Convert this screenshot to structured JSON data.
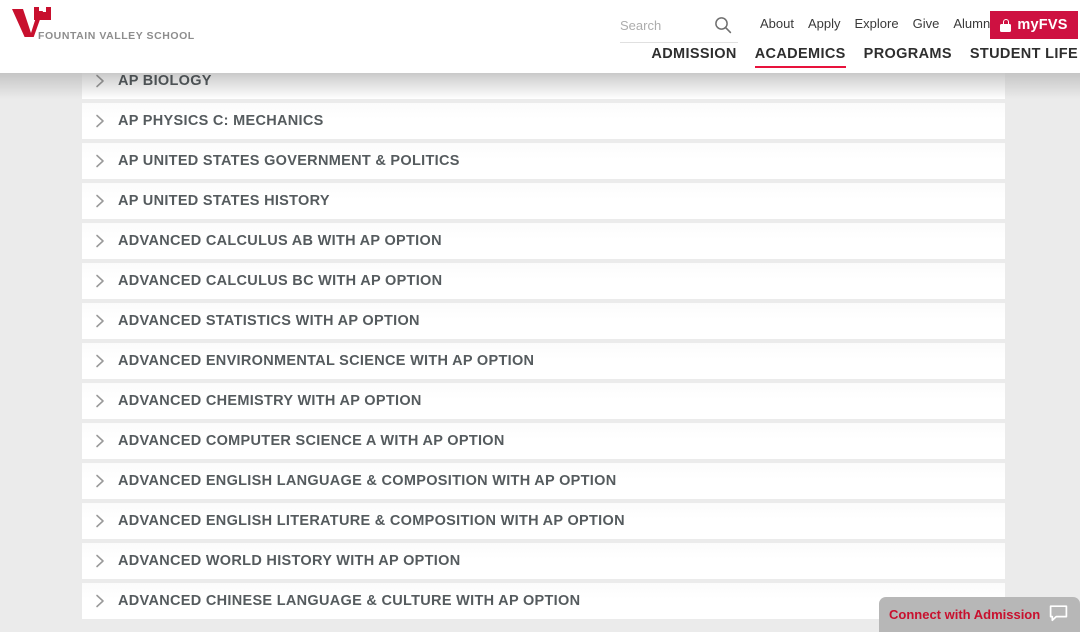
{
  "header": {
    "logo": {
      "icon": "fvs-v-logo-icon",
      "text": "FOUNTAIN VALLEY SCHOOL",
      "color": "#c8102e"
    },
    "search": {
      "placeholder": "Search",
      "value": "",
      "icon": "search-icon"
    },
    "utility_links": [
      {
        "label": "About"
      },
      {
        "label": "Apply"
      },
      {
        "label": "Explore"
      },
      {
        "label": "Give"
      },
      {
        "label": "Alumni"
      }
    ],
    "myfvs_button": {
      "label": "myFVS",
      "icon": "lock-icon",
      "color": "#ce1141"
    },
    "main_nav": {
      "active": "ACADEMICS",
      "accent_color": "#e8123c",
      "items": [
        {
          "label": "ADMISSION",
          "active": false
        },
        {
          "label": "ACADEMICS",
          "active": true
        },
        {
          "label": "PROGRAMS",
          "active": false
        },
        {
          "label": "STUDENT LIFE",
          "active": false
        }
      ]
    }
  },
  "main": {
    "accordion": {
      "item_icon": "chevron-right-icon",
      "items": [
        {
          "label": "AP BIOLOGY"
        },
        {
          "label": "AP PHYSICS C: MECHANICS"
        },
        {
          "label": "AP UNITED STATES GOVERNMENT & POLITICS"
        },
        {
          "label": "AP UNITED STATES HISTORY"
        },
        {
          "label": "ADVANCED CALCULUS AB WITH AP OPTION"
        },
        {
          "label": "ADVANCED CALCULUS BC WITH AP OPTION"
        },
        {
          "label": "ADVANCED STATISTICS WITH AP OPTION"
        },
        {
          "label": "ADVANCED ENVIRONMENTAL SCIENCE WITH AP OPTION"
        },
        {
          "label": "ADVANCED CHEMISTRY WITH AP OPTION"
        },
        {
          "label": "ADVANCED COMPUTER SCIENCE A WITH AP OPTION"
        },
        {
          "label": "ADVANCED ENGLISH LANGUAGE & COMPOSITION WITH AP OPTION"
        },
        {
          "label": "ADVANCED ENGLISH LITERATURE & COMPOSITION WITH AP OPTION"
        },
        {
          "label": "ADVANCED WORLD HISTORY WITH AP OPTION"
        },
        {
          "label": "ADVANCED CHINESE LANGUAGE & CULTURE WITH AP OPTION"
        }
      ]
    }
  },
  "chat_widget": {
    "label": "Connect with Admission",
    "icon": "chat-bubble-icon",
    "text_color": "#c8102e",
    "background_color": "#b7b7b7"
  }
}
